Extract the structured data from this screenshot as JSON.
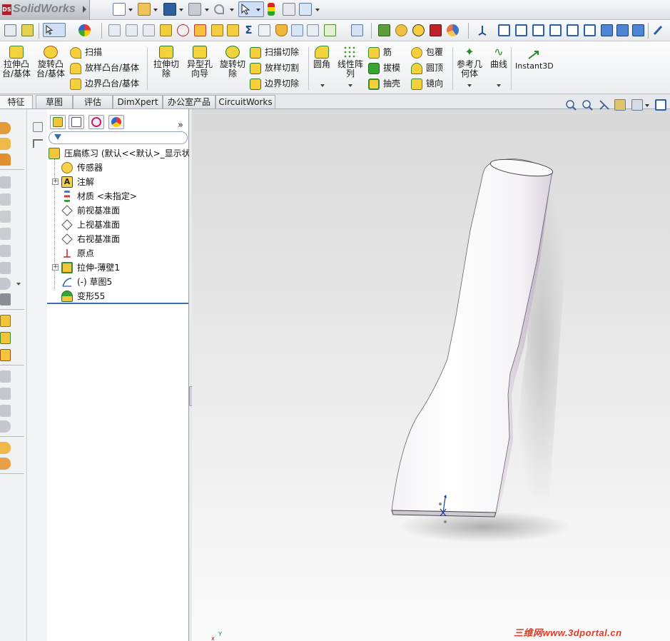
{
  "app": {
    "logo_text": "SolidWorks",
    "logo_badge": "DS"
  },
  "command_manager": {
    "extrude_boss": "拉伸凸台/基体",
    "revolve_boss": "旋转凸台/基体",
    "sweep": "扫描",
    "loft_boss": "放样凸台/基体",
    "boundary_boss": "边界凸台/基体",
    "extrude_cut": "拉伸切除",
    "hole_wizard": "异型孔向导",
    "revolve_cut": "旋转切除",
    "sweep_cut": "扫描切除",
    "loft_cut": "放样切割",
    "boundary_cut": "边界切除",
    "fillet": "圆角",
    "linear_pattern": "线性阵列",
    "rib": "筋",
    "draft": "拔模",
    "shell": "抽壳",
    "wrap": "包覆",
    "dome": "圆顶",
    "mirror": "镜向",
    "ref_geometry": "参考几何体",
    "curves": "曲线",
    "instant3d": "Instant3D"
  },
  "tabs": [
    "特征",
    "草图",
    "评估",
    "DimXpert",
    "办公室产品",
    "CircuitWorks"
  ],
  "feature_tree": {
    "root": "压扁练习 (默认<<默认>_显示状",
    "items": [
      {
        "label": "传感器"
      },
      {
        "label": "注解"
      },
      {
        "label": "材质 <未指定>"
      },
      {
        "label": "前视基准面"
      },
      {
        "label": "上视基准面"
      },
      {
        "label": "右视基准面"
      },
      {
        "label": "原点"
      },
      {
        "label": "拉伸-薄壁1"
      },
      {
        "label": "(-) 草图5"
      },
      {
        "label": "变形55"
      }
    ],
    "expand_glyph": "+",
    "more_glyph": "»"
  },
  "watermark": "三维网www.3dportal.cn",
  "triad": {
    "x": "x",
    "y": "Y"
  },
  "colors": {
    "accent": "#3d6fb6",
    "brand": "#b02027",
    "watermark": "#e23a25",
    "feature_yellow": "#f2c80f",
    "feature_green": "#3aa335"
  }
}
